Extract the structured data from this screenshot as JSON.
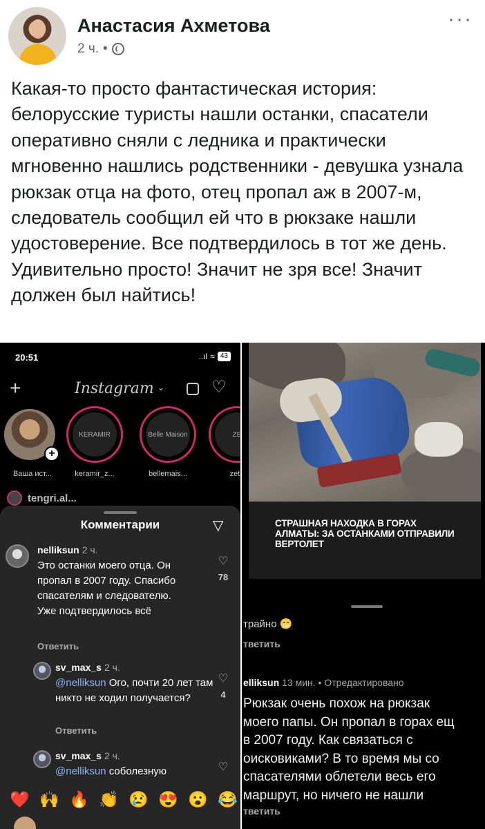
{
  "post": {
    "author": "Анастасия Ахметова",
    "time": "2 ч.",
    "separator": "•",
    "more": "···",
    "text": "Какая-то просто фантастическая история: белорусские туристы нашли останки, спасатели оперативно сняли с ледника и практически мгновенно нашлись родственники - девушка узнала рюкзак отца на фото, отец пропал аж в 2007-м, следователь сообщил ей что в рюкзаке нашли удостоверение. Все подтвердилось в тот же день. Удивительно просто! Значит не зря все! Значит должен был найтись!"
  },
  "left_screenshot": {
    "status": {
      "time": "20:51",
      "signal": "..ıl",
      "battery": "43"
    },
    "app_logo": "Instagram",
    "stories": [
      {
        "label": "Ваша ист...",
        "inner": ""
      },
      {
        "label": "keramir_z...",
        "inner": "KERAMIR"
      },
      {
        "label": "bellemais...",
        "inner": "Belle Maison"
      },
      {
        "label": "zeta",
        "inner": "ZE"
      }
    ],
    "feed_user": "tengri.al...",
    "sheet_title": "Комментарии",
    "comments": [
      {
        "user": "nelliksun",
        "time": "2 ч.",
        "text": "Это останки моего отца. Он пропал в 2007 году. Спасибо спасателям и следователю. Уже подтвердилось всё",
        "reply": "Ответить",
        "likes": "78"
      },
      {
        "user": "sv_max_s",
        "time": "2 ч.",
        "mention": "@nelliksun",
        "text": " Ого, почти 20 лет там никто не ходил получается?",
        "reply": "Ответить",
        "likes": "4"
      },
      {
        "user": "sv_max_s",
        "time": "2 ч.",
        "mention": "@nelliksun",
        "text": " соболезную",
        "likes": ""
      }
    ],
    "emojis": [
      "❤️",
      "🙌",
      "🔥",
      "👏",
      "😢",
      "😍",
      "😮",
      "😂"
    ]
  },
  "right_screenshot": {
    "headline": "Страшная находка в горах Алматы: за останками отправили вертолет",
    "prev_comment_tail": "трайно 😁",
    "prev_reply": "тветить",
    "comment_user": "elliksun",
    "comment_meta": "13 мин. • Отредактировано",
    "comment_text": "Рюкзак очень похож на рюкзак\nмоего папы. Он пропал в горах ещ\nв 2007 году. Как связаться с\nоисковиками? В то время мы со\nспасателями облетели весь его\nмаршрут, но ничего не нашли",
    "reply": "тветить"
  }
}
